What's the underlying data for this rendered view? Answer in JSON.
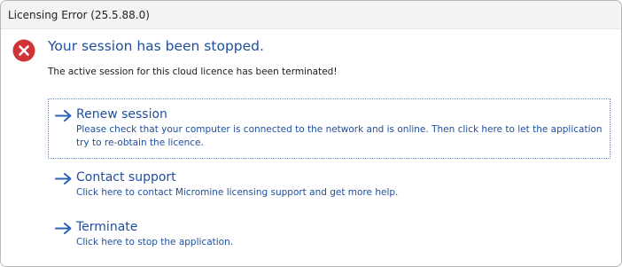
{
  "window": {
    "title": "Licensing Error (25.5.88.0)"
  },
  "icon": {
    "name": "error-icon",
    "color": "#d13438"
  },
  "message": {
    "heading": "Your session has been stopped.",
    "detail": "The active session for this cloud licence has been terminated!"
  },
  "commands": [
    {
      "title": "Renew session",
      "description": "Please check that your computer is connected to the network and is online. Then click here to let the application try to re-obtain the licence.",
      "icon": "arrow-right-icon",
      "focused": true
    },
    {
      "title": "Contact support",
      "description": "Click here to contact Micromine licensing support and get more help.",
      "icon": "arrow-right-icon",
      "focused": false
    },
    {
      "title": "Terminate",
      "description": "Click here to stop the application.",
      "icon": "arrow-right-icon",
      "focused": false
    }
  ],
  "colors": {
    "link": "#1f4e9c",
    "accent_arrow": "#2b63b8"
  }
}
